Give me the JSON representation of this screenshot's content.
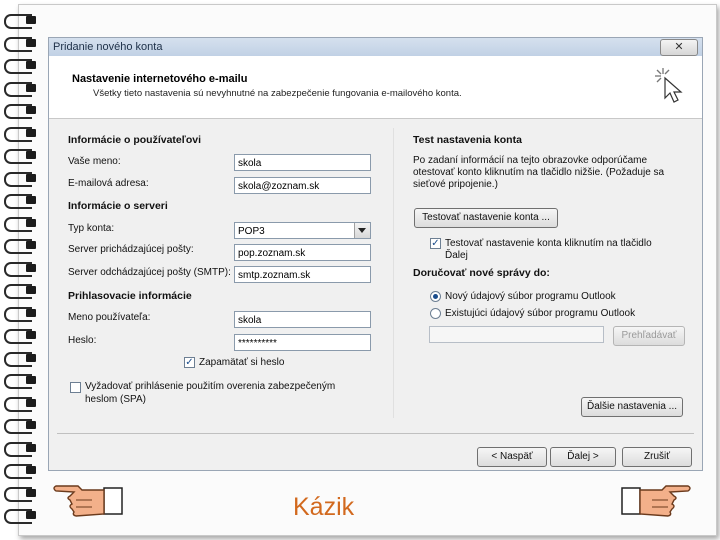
{
  "window": {
    "title": "Pridanie nového konta",
    "close_label": "✕"
  },
  "header": {
    "heading": "Nastavenie internetového e-mailu",
    "subheading": "Všetky tieto nastavenia sú nevyhnutné na zabezpečenie fungovania e-mailového konta."
  },
  "user_info": {
    "section_title": "Informácie o používateľovi",
    "name_label": "Vaše meno:",
    "name_value": "skola",
    "email_label": "E-mailová adresa:",
    "email_value": "skola@zoznam.sk"
  },
  "server_info": {
    "section_title": "Informácie o serveri",
    "account_type_label": "Typ konta:",
    "account_type_value": "POP3",
    "incoming_label": "Server prichádzajúcej pošty:",
    "incoming_value": "pop.zoznam.sk",
    "outgoing_label": "Server odchádzajúcej pošty (SMTP):",
    "outgoing_value": "smtp.zoznam.sk"
  },
  "login_info": {
    "section_title": "Prihlasovacie informácie",
    "username_label": "Meno používateľa:",
    "username_value": "skola",
    "password_label": "Heslo:",
    "password_value": "**********",
    "remember_label": "Zapamätať si heslo",
    "remember_checked": true,
    "spa_label_line1": "Vyžadovať prihlásenie použitím overenia zabezpečeným",
    "spa_label_line2": "heslom (SPA)",
    "spa_checked": false
  },
  "test_settings": {
    "section_title": "Test nastavenia konta",
    "description_line1": "Po zadaní informácií na tejto obrazovke odporúčame",
    "description_line2": "otestovať konto kliknutím na tlačidlo nižšie. (Požaduje sa",
    "description_line3": "sieťové pripojenie.)",
    "test_button": "Testovať nastavenie konta ...",
    "test_checkbox_label_line1": "Testovať nastavenie konta kliknutím na tlačidlo",
    "test_checkbox_label_line2": "Ďalej",
    "test_checkbox_checked": true
  },
  "delivery": {
    "section_title": "Doručovať nové správy do:",
    "option_new": "Nový údajový súbor programu Outlook",
    "option_existing": "Existujúci údajový súbor programu Outlook",
    "selected": "option_new",
    "browse_button": "Prehľadávať"
  },
  "footer": {
    "more_settings_button": "Ďalšie nastavenia ...",
    "back_button": "< Naspäť",
    "next_button": "Ďalej >",
    "cancel_button": "Zrušiť"
  },
  "slide": {
    "caption": "Kázik"
  },
  "icons": [
    "close-icon",
    "cursor-click-icon",
    "dropdown-arrow-icon",
    "checkbox-icon",
    "radio-icon",
    "pointing-hand-icon"
  ],
  "colors": {
    "caption": "#d2691e",
    "titlebar": "#c1d1e5",
    "dialog_bg": "#f0f0f0"
  }
}
